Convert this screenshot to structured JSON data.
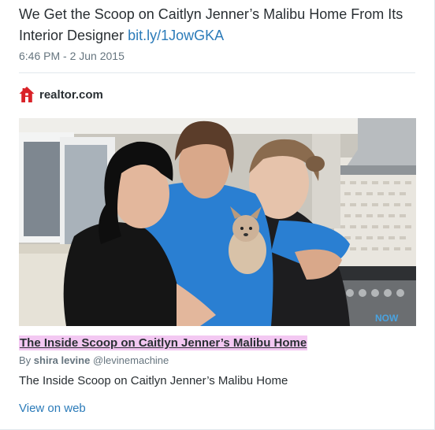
{
  "tweet": {
    "text": "We Get the Scoop on Caitlyn Jenner’s Malibu Home From Its Interior Designer ",
    "link_text": "bit.ly/1JowGKA",
    "timestamp": "6:46 PM - 2 Jun 2015"
  },
  "card": {
    "publisher": "realtor.com",
    "publisher_icon": "house-icon",
    "publisher_color": "#d92228",
    "image_alt": "Three women in a kitchen holding a small puppy",
    "title": "The Inside Scoop on Caitlyn Jenner’s Malibu Home",
    "byline_prefix": "By ",
    "author_name": "shira levine",
    "author_handle": "@levinemachine",
    "description": "The Inside Scoop on Caitlyn Jenner’s Malibu Home",
    "view_on_web": "View on web"
  },
  "actions": {
    "reply_icon": "reply-icon",
    "retweet_icon": "retweet-icon",
    "favorite_icon": "star-icon",
    "icon_color": "#66757f"
  },
  "colors": {
    "link": "#2b7bb9",
    "title_highlight": "#f3c8f2",
    "text": "#292f33",
    "muted": "#66757f"
  }
}
